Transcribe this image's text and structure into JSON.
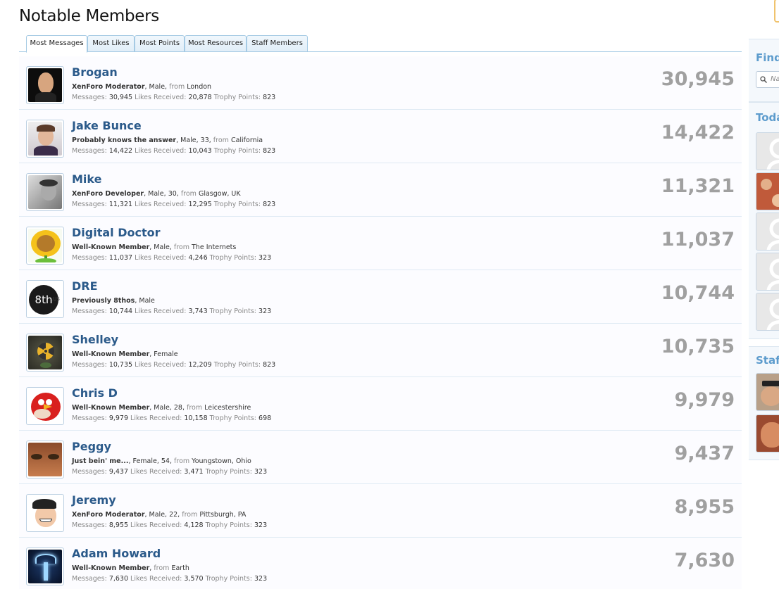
{
  "page": {
    "title": "Notable Members"
  },
  "tabs": [
    {
      "label": "Most Messages",
      "active": true
    },
    {
      "label": "Most Likes",
      "active": false
    },
    {
      "label": "Most Points",
      "active": false
    },
    {
      "label": "Most Resources",
      "active": false
    },
    {
      "label": "Staff Members",
      "active": false
    }
  ],
  "labels": {
    "from": "from",
    "messages": "Messages:",
    "likes_received": "Likes Received:",
    "trophy_points": "Trophy Points:"
  },
  "members": [
    {
      "name": "Brogan",
      "title": "XenForo Moderator",
      "details": "Male",
      "location": "London",
      "messages": "30,945",
      "likes": "20,878",
      "points": "823",
      "count": "30,945",
      "avatar_icon": "bald-man-avatar"
    },
    {
      "name": "Jake Bunce",
      "title": "Probably knows the answer",
      "details": "Male, 33",
      "location": "California",
      "messages": "14,422",
      "likes": "10,043",
      "points": "823",
      "count": "14,422",
      "avatar_icon": "young-man-avatar"
    },
    {
      "name": "Mike",
      "title": "XenForo Developer",
      "details": "Male, 30",
      "location": "Glasgow, UK",
      "messages": "11,321",
      "likes": "12,295",
      "points": "823",
      "count": "11,321",
      "avatar_icon": "bw-photo-avatar"
    },
    {
      "name": "Digital Doctor",
      "title": "Well-Known Member",
      "details": "Male",
      "location": "The Internets",
      "messages": "11,037",
      "likes": "4,246",
      "points": "323",
      "count": "11,037",
      "avatar_icon": "sunflower-avatar"
    },
    {
      "name": "DRE",
      "title": "Previously 8thos",
      "details": "Male",
      "location": "",
      "messages": "10,744",
      "likes": "3,743",
      "points": "323",
      "count": "10,744",
      "avatar_icon": "8th-logo-avatar",
      "avatar_text": "8th",
      "avatar_subtext": ".US"
    },
    {
      "name": "Shelley",
      "title": "Well-Known Member",
      "details": "Female",
      "location": "",
      "messages": "10,735",
      "likes": "12,209",
      "points": "823",
      "count": "10,735",
      "avatar_icon": "radiation-symbol-avatar"
    },
    {
      "name": "Chris D",
      "title": "Well-Known Member",
      "details": "Male, 28",
      "location": "Leicestershire",
      "messages": "9,979",
      "likes": "10,158",
      "points": "698",
      "count": "9,979",
      "avatar_icon": "angry-bird-avatar"
    },
    {
      "name": "Peggy",
      "title": "Just bein' me...",
      "details": "Female, 54",
      "location": "Youngstown, Ohio",
      "messages": "9,437",
      "likes": "3,471",
      "points": "323",
      "count": "9,437",
      "avatar_icon": "eyes-closeup-avatar"
    },
    {
      "name": "Jeremy",
      "title": "XenForo Moderator",
      "details": "Male, 22",
      "location": "Pittsburgh, PA",
      "messages": "8,955",
      "likes": "4,128",
      "points": "323",
      "count": "8,955",
      "avatar_icon": "cartoon-cap-avatar"
    },
    {
      "name": "Adam Howard",
      "title": "Well-Known Member",
      "details": "",
      "location": "Earth",
      "messages": "7,630",
      "likes": "3,570",
      "points": "323",
      "count": "7,630",
      "avatar_icon": "glowing-stag-avatar"
    }
  ],
  "sidebar": {
    "find_heading": "Find",
    "search_placeholder": "Na",
    "today_heading": "Toda",
    "staff_heading": "Staff"
  },
  "colors": {
    "link": "#2b5a8a",
    "count": "#a0a0a0",
    "tab_border": "#a5cae4",
    "sidebar_heading": "#5d9ccd"
  }
}
